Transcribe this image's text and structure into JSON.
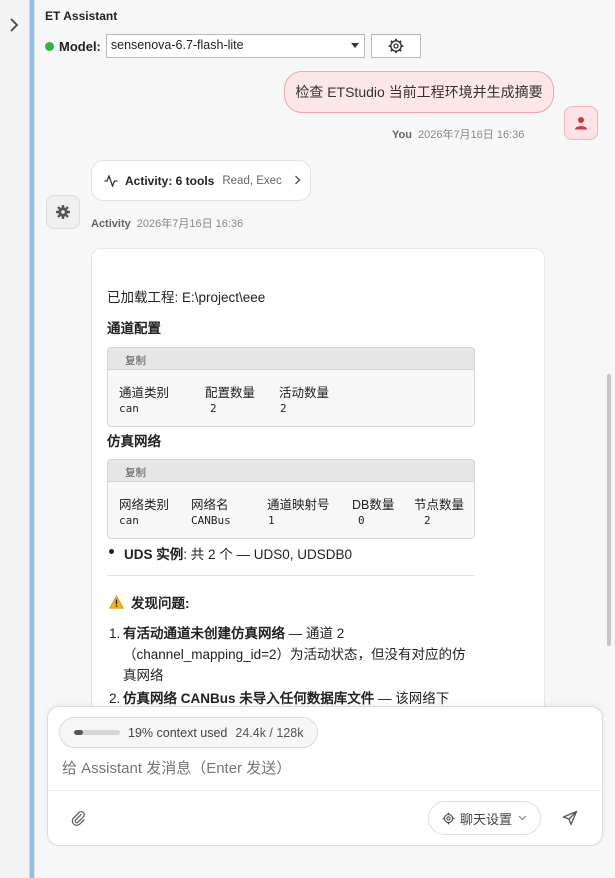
{
  "panel": {
    "title": "ET Assistant"
  },
  "model": {
    "label": "Model:",
    "selected": "sensenova-6.7-flash-lite",
    "status_color": "#2fb344"
  },
  "user_message": {
    "text": "检查 ETStudio 当前工程环境并生成摘要",
    "author": "You",
    "time": "2026年7月16日 16:36"
  },
  "activity": {
    "title": "Activity: 6 tools",
    "summary": "Read, Exec",
    "author": "Activity",
    "time": "2026年7月16日 16:36"
  },
  "response": {
    "loaded": "已加载工程: E:\\project\\eee",
    "channel_heading": "通道配置",
    "copy_label": "复制",
    "channel_table": {
      "headers": [
        "通道类别",
        "配置数量",
        "活动数量"
      ],
      "row": [
        "can",
        "2",
        "2"
      ]
    },
    "network_heading": "仿真网络",
    "network_table": {
      "headers": [
        "网络类别",
        "网络名",
        "通道映射号",
        "DB数量",
        "节点数量"
      ],
      "row": [
        "can",
        "CANBus",
        "1",
        "0",
        "2"
      ]
    },
    "uds_label": "UDS 实例",
    "uds_text": ": 共 2 个 — UDS0, UDSDB0",
    "issues_heading": "发现问题:",
    "issues": [
      {
        "num": "1.",
        "bold": "有活动通道未创建仿真网络",
        "text": " — 通道 2（channel_mapping_id=2）为活动状态，但没有对应的仿真网络"
      },
      {
        "num": "2.",
        "bold": "仿真网络 CANBus 未导入任何数据库文件",
        "text": " — 该网络下"
      }
    ]
  },
  "composer": {
    "context_percent": 19,
    "context_text": "19% context used",
    "tokens": "24.4k / 128k",
    "placeholder": "给 Assistant 发消息（Enter 发送）",
    "settings_label": "聊天设置"
  }
}
